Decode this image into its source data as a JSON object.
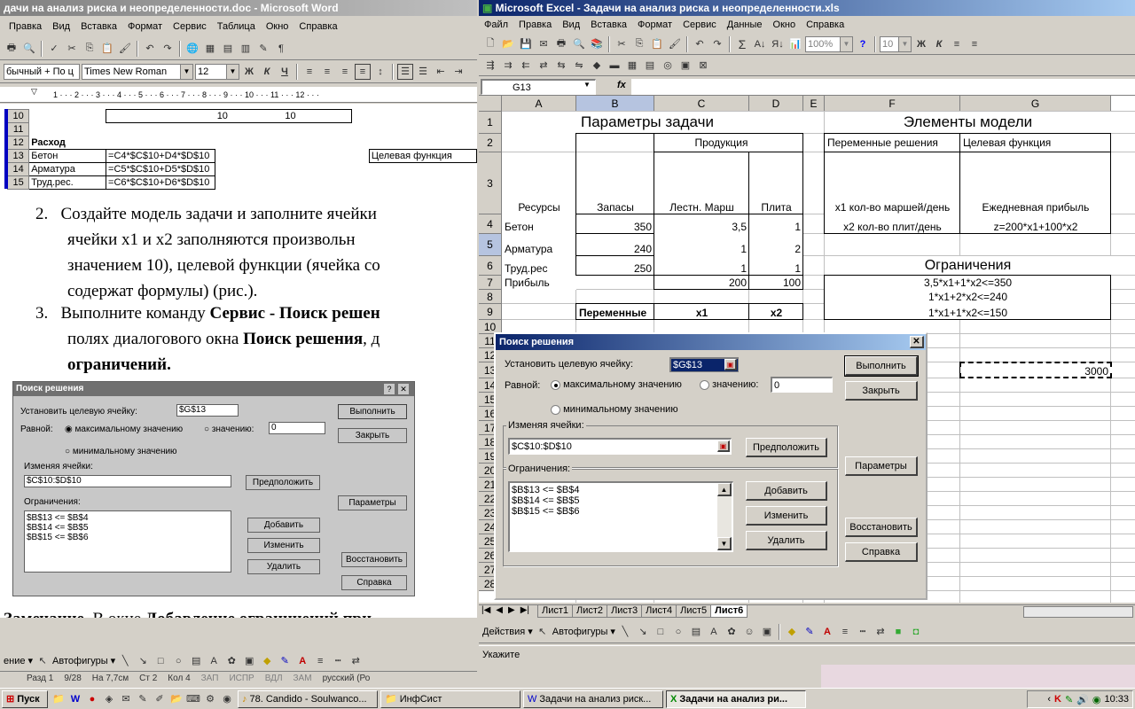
{
  "word": {
    "title": "дачи на анализ риска и неопределенности.doc - Microsoft Word",
    "menu": [
      "Правка",
      "Вид",
      "Вставка",
      "Формат",
      "Сервис",
      "Таблица",
      "Окно",
      "Справка"
    ],
    "style": "бычный + По ц",
    "font": "Times New Roman",
    "size": "12",
    "sheet_rows": [
      {
        "n": "10",
        "a": "",
        "b": "",
        "c": "10",
        "d": "10"
      },
      {
        "n": "11",
        "a": "",
        "b": "",
        "c": "",
        "d": ""
      },
      {
        "n": "12",
        "a": "Расход",
        "b": "",
        "c": "",
        "d": ""
      },
      {
        "n": "13",
        "a": "Бетон",
        "b": "=C4*$C$10+D4*$D$10",
        "c": "",
        "d": "",
        "f": "Целевая функция"
      },
      {
        "n": "14",
        "a": "Арматура",
        "b": "=C5*$C$10+D5*$D$10",
        "c": "",
        "d": ""
      },
      {
        "n": "15",
        "a": "Труд.рес.",
        "b": "=C6*$C$10+D6*$D$10",
        "c": "",
        "d": ""
      }
    ],
    "para2_num": "2.",
    "para2_l1": "Создайте модель задачи и заполните ячейки",
    "para2_l2": "ячейки  x1  и  x2  заполняются  произвольн",
    "para2_l3": "значением 10), целевой функции (ячейка со",
    "para2_l4": "содержат формулы) (рис.).",
    "para3_num": "3.",
    "para3_l1a": "Выполните команду ",
    "para3_l1b": "Сервис - Поиск решен",
    "para3_l2a": "полях диалогового окна ",
    "para3_l2b": "Поиск решения",
    "para3_l2c": ", д",
    "para3_l3": "ограничений.",
    "note_bold": "Замечание.",
    "note_text": " В окне ",
    "note_bold2": "Добавление ограничений при",
    "draw_actions": "ение ▾",
    "draw_autoshapes": "Автофигуры ▾",
    "status": [
      "Разд 1",
      "9/28",
      "На 7,7см",
      "Ст 2",
      "Кол 4",
      "ЗАП",
      "ИСПР",
      "ВДЛ",
      "ЗАМ",
      "русский (Ро"
    ]
  },
  "doc_dialog": {
    "title": "Поиск решения",
    "target_label": "Установить целевую ячейку:",
    "target_value": "$G$13",
    "equal_label": "Равной:",
    "max_label": "максимальному значению",
    "value_label": "значению:",
    "value_value": "0",
    "min_label": "минимальному значению",
    "changing_label": "Изменяя ячейки:",
    "changing_value": "$C$10:$D$10",
    "constraints_label": "Ограничения:",
    "constraints": [
      "$B$13 <= $B$4",
      "$B$14 <= $B$5",
      "$B$15 <= $B$6"
    ],
    "run": "Выполнить",
    "close": "Закрыть",
    "guess": "Предположить",
    "params": "Параметры",
    "add": "Добавить",
    "change": "Изменить",
    "restore": "Восстановить",
    "delete": "Удалить",
    "help": "Справка"
  },
  "excel": {
    "title": "Microsoft Excel - Задачи на анализ риска и неопределенности.xls",
    "menu": [
      "Файл",
      "Правка",
      "Вид",
      "Вставка",
      "Формат",
      "Сервис",
      "Данные",
      "Окно",
      "Справка"
    ],
    "zoom": "100%",
    "font_size": "10",
    "namebox": "G13",
    "fx": "fx",
    "cols": [
      {
        "l": "A",
        "w": 84
      },
      {
        "l": "B",
        "w": 88
      },
      {
        "l": "C",
        "w": 107
      },
      {
        "l": "D",
        "w": 61
      },
      {
        "l": "E",
        "w": 24
      },
      {
        "l": "F",
        "w": 153
      },
      {
        "l": "G",
        "w": 170
      }
    ],
    "rows": [
      "1",
      "2",
      "3",
      "4",
      "5",
      "6",
      "7",
      "8",
      "9",
      "10",
      "11",
      "12",
      "13",
      "14",
      "15",
      "16",
      "17",
      "18",
      "19",
      "20",
      "21",
      "22",
      "23",
      "24",
      "25",
      "26",
      "27",
      "28"
    ],
    "cells": {
      "title_params": "Параметры задачи",
      "title_model": "Элементы модели",
      "produkciya": "Продукция",
      "var_dec": "Переменные решения",
      "target_fn": "Целевая функция",
      "resources": "Ресурсы",
      "stocks": "Запасы",
      "stairs": "Лестн. Марш",
      "plate": "Плита",
      "x1_desc": "x1 кол-во маршей/день",
      "profit_desc": "Ежедневная прибыль",
      "beton": "Бетон",
      "beton_stock": "350",
      "beton_c": "3,5",
      "beton_d": "1",
      "x2_desc": "x2 кол-во плит/день",
      "z_formula": "z=200*x1+100*x2",
      "armatura": "Арматура",
      "arm_stock": "240",
      "arm_c": "1",
      "arm_d": "2",
      "constraints_title": "Ограничения",
      "trud": "Труд.рес",
      "trud_stock": "250",
      "trud_c": "1",
      "trud_d": "1",
      "profit": "Прибыль",
      "profit_c": "200",
      "profit_d": "100",
      "con1": "3,5*x1+1*x2<=350",
      "con2": "1*x1+2*x2<=240",
      "con3": "1*x1+1*x2<=150",
      "variables": "Переменные",
      "x1": "x1",
      "x2": "x2",
      "g13": "3000"
    },
    "sheets": [
      "Лист1",
      "Лист2",
      "Лист3",
      "Лист4",
      "Лист5",
      "Лист6"
    ],
    "active_sheet": "Лист6",
    "draw_actions": "Действия ▾",
    "draw_autoshapes": "Автофигуры ▾",
    "status": "Укажите"
  },
  "dialog": {
    "title": "Поиск решения",
    "target_label": "Установить целевую ячейку:",
    "target_value": "$G$13",
    "equal_label": "Равной:",
    "max_label": "максимальному значению",
    "value_label": "значению:",
    "value_value": "0",
    "min_label": "минимальному значению",
    "changing_label": "Изменяя ячейки:",
    "changing_value": "$C$10:$D$10",
    "constraints_label": "Ограничения:",
    "constraints": [
      "$B$13 <= $B$4",
      "$B$14 <= $B$5",
      "$B$15 <= $B$6"
    ],
    "run": "Выполнить",
    "close": "Закрыть",
    "guess": "Предположить",
    "params": "Параметры",
    "add": "Добавить",
    "change": "Изменить",
    "delete": "Удалить",
    "restore": "Восстановить",
    "help": "Справка"
  },
  "taskbar": {
    "start": "Пуск",
    "items": [
      {
        "label": "78. Candido - Soulwanco...",
        "active": false
      },
      {
        "label": "ИнфСист",
        "active": false
      },
      {
        "label": "Задачи на анализ риск...",
        "active": false
      },
      {
        "label": "Задачи на анализ ри...",
        "active": true
      }
    ],
    "clock": "10:33"
  }
}
